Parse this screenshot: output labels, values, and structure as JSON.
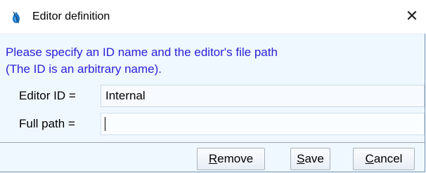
{
  "window": {
    "title": "Editor definition",
    "icon": "app-logo-icon",
    "close_glyph": "✕"
  },
  "message": {
    "line1": "Please specify an ID name and the editor's file path",
    "line2": "(The ID is an arbitrary name).",
    "color": "#2a20d8"
  },
  "form": {
    "editor_id_label": "Editor ID =",
    "editor_id_value": "Internal",
    "full_path_label": "Full path =",
    "full_path_value": ""
  },
  "buttons": {
    "remove": {
      "mnemonic": "R",
      "rest": "emove"
    },
    "save": {
      "mnemonic": "S",
      "rest": "ave"
    },
    "cancel": {
      "mnemonic": "C",
      "rest": "ancel"
    }
  }
}
